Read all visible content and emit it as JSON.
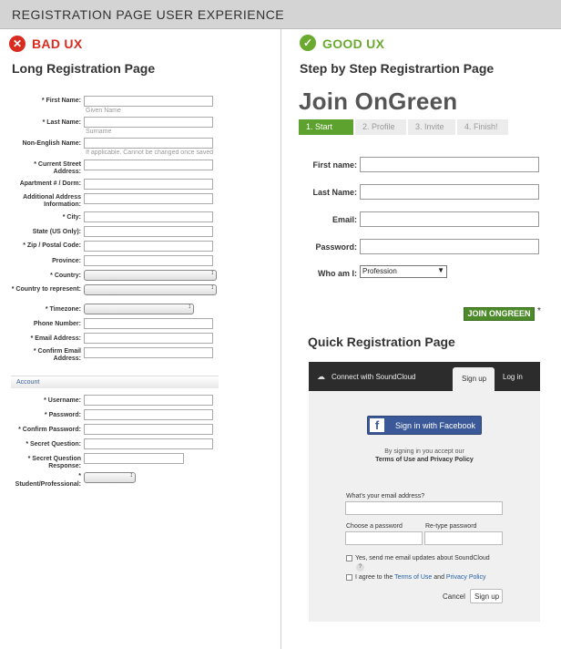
{
  "banner": "REGISTRATION PAGE USER EXPERIENCE",
  "bad": {
    "label": "BAD UX",
    "title": "Long Registration Page",
    "color": "#d92b1f"
  },
  "good": {
    "label": "GOOD UX",
    "title": "Step by Step Registrartion Page",
    "color": "#6aab2f"
  },
  "long_form": {
    "first_name": "* First Name:",
    "given_name_hint": "Given Name",
    "last_name": "* Last Name:",
    "surname_hint": "Surname",
    "non_english": "Non-English Name:",
    "non_english_hint": "If applicable. Cannot be changed once saved",
    "street": "* Current Street Address:",
    "apartment": "Apartment # / Dorm:",
    "additional": "Additional Address Information:",
    "city": "* City:",
    "state": "State (US Only):",
    "zip": "* Zip / Postal Code:",
    "province": "Province:",
    "country": "* Country:",
    "country_rep": "* Country to represent:",
    "timezone": "* Timezone:",
    "phone": "Phone Number:",
    "email": "* Email Address:",
    "confirm_email": "* Confirm Email Address:",
    "account": "Account",
    "username": "* Username:",
    "password": "* Password:",
    "confirm_password": "* Confirm Password:",
    "secret_q": "* Secret Question:",
    "secret_r": "* Secret Question Response:",
    "student_star": "*",
    "student": "Student/Professional:"
  },
  "join": {
    "title": "Join OnGreen",
    "steps": [
      "1. Start",
      "2. Profile",
      "3. Invite",
      "4. Finish!"
    ],
    "first_name": "First name:",
    "last_name": "Last Name:",
    "email": "Email:",
    "password": "Password:",
    "who": "Who am I:",
    "who_value": "Profession",
    "button": "JOIN ONGREEN",
    "asterisk": "*"
  },
  "quick": {
    "title": "Quick Registration Page",
    "connect": "Connect with SoundCloud",
    "tab_signup": "Sign up",
    "tab_login": "Log in",
    "fb": "Sign in with Facebook",
    "agree_1": "By signing in you accept our",
    "agree_2": "Terms of Use and Privacy Policy",
    "email_q": "What's your email address?",
    "choose_pw": "Choose a password",
    "retype_pw": "Re-type password",
    "updates": "Yes, send me email updates about SoundCloud",
    "question_mark": "?",
    "agree_pre": "I agree to the",
    "terms": "Terms of Use",
    "and": "and",
    "privacy": "Privacy Policy",
    "cancel": "Cancel",
    "signup_btn": "Sign up"
  }
}
